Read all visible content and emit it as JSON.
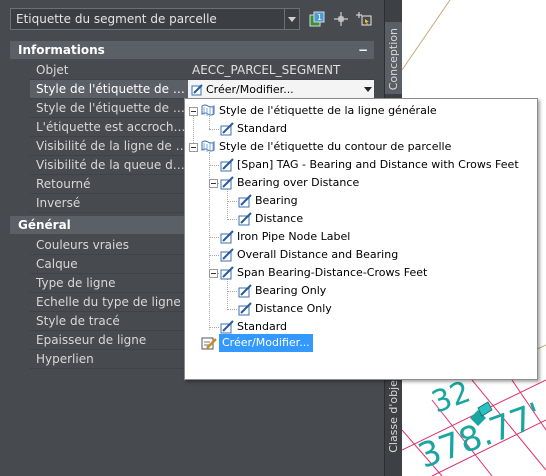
{
  "selector": {
    "value": "Etiquette du segment de parcelle"
  },
  "categories": {
    "informations": {
      "label": "Informations",
      "toggle": "−"
    },
    "general": {
      "label": "Général",
      "toggle": ""
    }
  },
  "info_rows": [
    {
      "label": "Objet",
      "value": "AECC_PARCEL_SEGMENT"
    },
    {
      "label": "Style de l'étiquette de la l...",
      "value": "Créer/Modifier..."
    },
    {
      "label": "Style de l'étiquette de la...",
      "value": ""
    },
    {
      "label": "L'étiquette est accrochée",
      "value": ""
    },
    {
      "label": "Visibilité de la ligne de re...",
      "value": ""
    },
    {
      "label": "Visibilité de la queue de l...",
      "value": ""
    },
    {
      "label": "Retourné",
      "value": ""
    },
    {
      "label": "Inversé",
      "value": ""
    }
  ],
  "general_rows": [
    {
      "label": "Couleurs vraies"
    },
    {
      "label": "Calque"
    },
    {
      "label": "Type de ligne"
    },
    {
      "label": "Echelle du type de ligne"
    },
    {
      "label": "Style de tracé"
    },
    {
      "label": "Epaisseur de ligne"
    },
    {
      "label": "Hyperlien"
    }
  ],
  "side_tabs": {
    "conception": "Conception",
    "objets": "Classe d'objets"
  },
  "tree": {
    "root1": "Style de l'étiquette de la ligne générale",
    "root1_children": [
      "Standard"
    ],
    "root2": "Style de l'étiquette du contour de parcelle",
    "items": [
      "[Span] TAG - Bearing and Distance with Crows Feet",
      "Bearing over Distance",
      "Bearing",
      "Distance",
      "Iron Pipe Node Label",
      "Overall Distance and Bearing",
      "Span Bearing-Distance-Crows Feet",
      "Bearing Only",
      "Distance Only",
      "Standard"
    ],
    "create": "Créer/Modifier..."
  },
  "canvas_labels": {
    "label1": "32",
    "label2": "378.77'"
  },
  "colors": {
    "accent_selection": "#3399ff",
    "canvas_grid": "#e0306a",
    "canvas_label": "#1aa6a0",
    "parcel_line": "#c8a878"
  }
}
